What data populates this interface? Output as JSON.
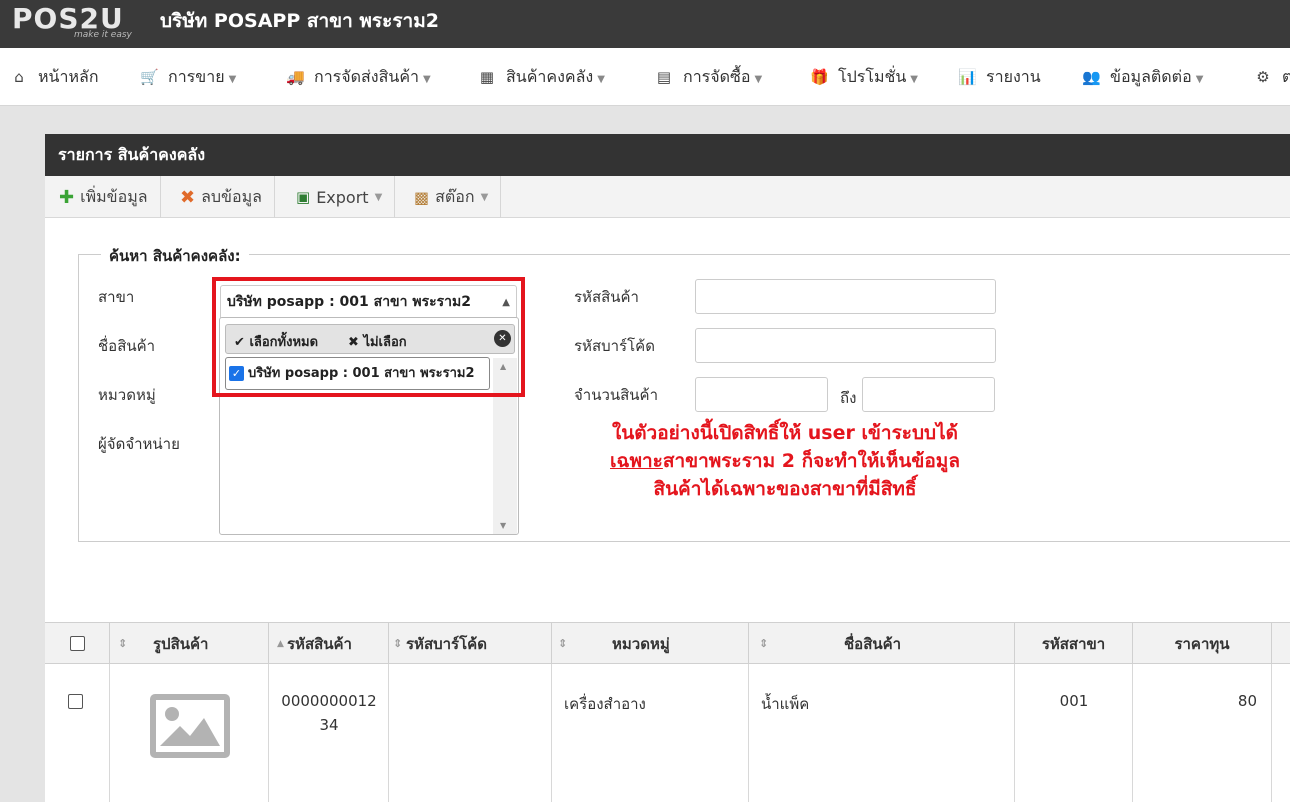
{
  "brand": {
    "logo": "POS2U",
    "tagline": "make it easy",
    "company": "บริษัท POSAPP สาขา พระราม2"
  },
  "nav": [
    {
      "icon": "home-icon",
      "glyph": "⌂",
      "label": "หน้าหลัก",
      "caret": false
    },
    {
      "icon": "cart-icon",
      "glyph": "🛒",
      "label": "การขาย",
      "caret": true
    },
    {
      "icon": "truck-icon",
      "glyph": "🚚",
      "label": "การจัดส่งสินค้า",
      "caret": true
    },
    {
      "icon": "cubes-icon",
      "glyph": "▦",
      "label": "สินค้าคงคลัง",
      "caret": true
    },
    {
      "icon": "document-icon",
      "glyph": "▤",
      "label": "การจัดซื้อ",
      "caret": true
    },
    {
      "icon": "gift-icon",
      "glyph": "🎁",
      "label": "โปรโมชั่น",
      "caret": true
    },
    {
      "icon": "bar-chart-icon",
      "glyph": "📊",
      "label": "รายงาน",
      "caret": false
    },
    {
      "icon": "users-icon",
      "glyph": "👥",
      "label": "ข้อมูลติดต่อ",
      "caret": true
    },
    {
      "icon": "gear-icon",
      "glyph": "⚙",
      "label": "ต",
      "caret": false
    }
  ],
  "panel": {
    "title": "รายการ สินค้าคงคลัง"
  },
  "toolbar": {
    "add": "เพิ่มข้อมูล",
    "delete": "ลบข้อมูล",
    "export": "Export",
    "stock": "สต๊อก"
  },
  "search": {
    "legend": "ค้นหา สินค้าคงคลัง:",
    "branch_label": "สาขา",
    "product_name_label": "ชื่อสินค้า",
    "category_label": "หมวดหมู่",
    "supplier_label": "ผู้จัดจำหน่าย",
    "product_code_label": "รหัสสินค้า",
    "barcode_label": "รหัสบาร์โค้ด",
    "quantity_label": "จำนวนสินค้า",
    "to_label": "ถึง",
    "branch_selected": "บริษัท posapp : 001 สาขา พระราม2",
    "select_all": "เลือกทั้งหมด",
    "deselect": "ไม่เลือก",
    "option": "บริษัท posapp : 001 สาขา พระราม2"
  },
  "note": {
    "line1": "ในตัวอย่างนี้เปิดสิทธิ์ให้ user เข้าระบบได้",
    "line2_u": "เฉพาะ",
    "line2_rest": "สาขาพระราม 2 ก็จะทำให้เห็นข้อมูล",
    "line3": "สินค้าได้เฉพาะของสาขาที่มีสิทธิ์"
  },
  "table": {
    "headers": [
      "รูปสินค้า",
      "รหัสสินค้า",
      "รหัสบาร์โค้ด",
      "หมวดหมู่",
      "ชื่อสินค้า",
      "รหัสสาขา",
      "ราคาทุน"
    ],
    "rows": [
      {
        "code_line1": "0000000012",
        "code_line2": "34",
        "barcode": "",
        "category": "เครื่องสำอาง",
        "name": "น้ำแพ็ค",
        "branch": "001",
        "cost": "80"
      }
    ]
  }
}
